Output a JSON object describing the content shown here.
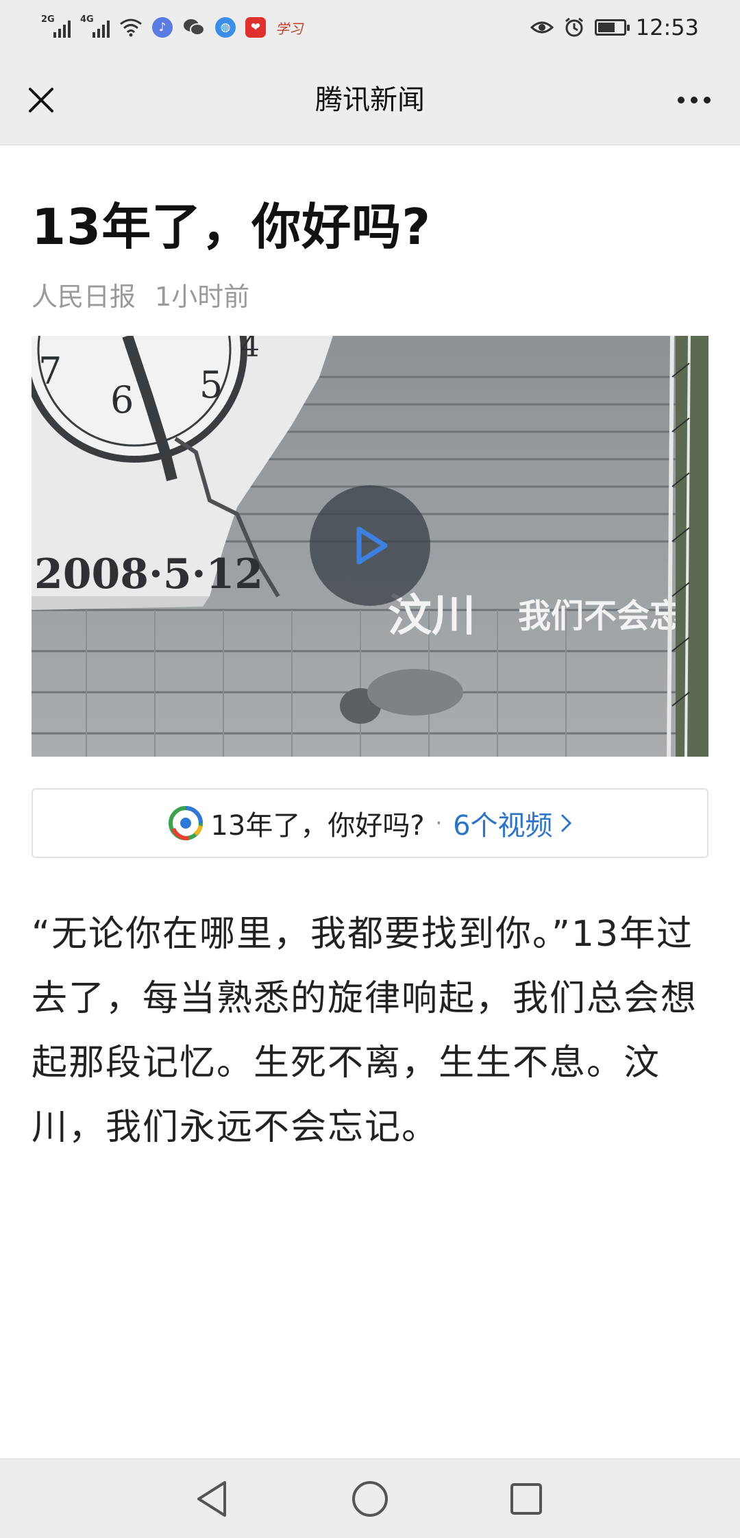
{
  "status_bar": {
    "signal1": "2G",
    "signal2": "4G",
    "study_label": "学习",
    "time": "12:53",
    "icons": [
      "wifi-icon",
      "music-icon",
      "wechat-icon",
      "browser-icon",
      "app-red-icon",
      "study-icon",
      "eye-icon",
      "alarm-icon",
      "battery-icon"
    ]
  },
  "nav": {
    "title": "腾讯新闻",
    "close_icon": "close-icon",
    "more_icon": "more-dots-icon"
  },
  "article": {
    "title": "13年了，你好吗?",
    "source": "人民日报",
    "time": "1小时前"
  },
  "video": {
    "date_text": "2008·5·12",
    "caption_main": "汶川",
    "caption_sub": "我们不会忘",
    "play_icon": "play-icon"
  },
  "video_card": {
    "title": "13年了，你好吗?",
    "separator": "·",
    "link": "6个视频",
    "icon": "tencent-news-logo",
    "link_color": "#2b74c6"
  },
  "body": {
    "text": "“无论你在哪里，我都要找到你。”13年过去了，每当熟悉的旋律响起，我们总会想起那段记忆。生死不离，生生不息。汶川，我们永远不会忘记。"
  },
  "system_nav": {
    "icons": [
      "back-icon",
      "home-icon",
      "recents-icon"
    ]
  }
}
